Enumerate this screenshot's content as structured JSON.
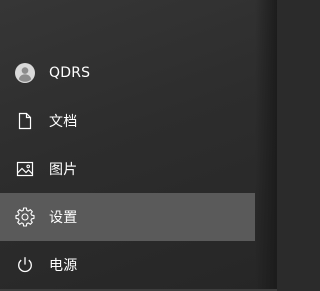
{
  "start_menu": {
    "items": [
      {
        "label": "QDRS",
        "icon": "user-avatar-icon",
        "selected": false
      },
      {
        "label": "文档",
        "icon": "document-icon",
        "selected": false
      },
      {
        "label": "图片",
        "icon": "picture-icon",
        "selected": false
      },
      {
        "label": "设置",
        "icon": "gear-icon",
        "selected": true
      },
      {
        "label": "电源",
        "icon": "power-icon",
        "selected": false
      }
    ]
  },
  "colors": {
    "background": "#2d2d2d",
    "selected_background": "#5a5a5a",
    "text": "#ffffff",
    "avatar": "#d9d9d9"
  }
}
